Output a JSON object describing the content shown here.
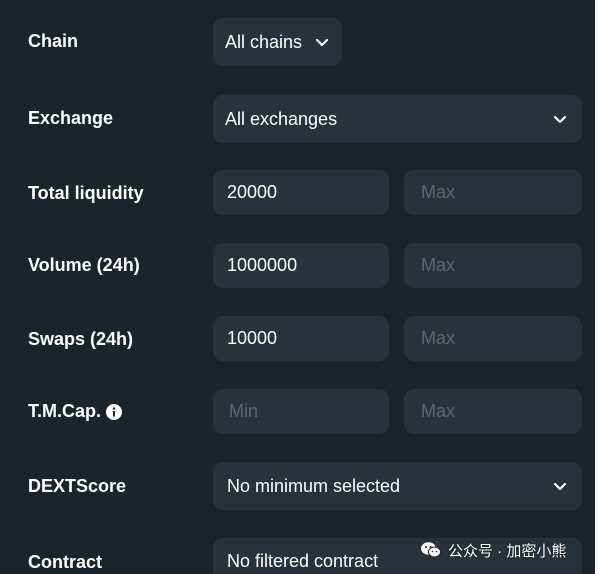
{
  "filters": {
    "chain": {
      "label": "Chain",
      "value": "All chains"
    },
    "exchange": {
      "label": "Exchange",
      "value": "All exchanges"
    },
    "total_liquidity": {
      "label": "Total liquidity",
      "min_value": "20000",
      "max_placeholder": "Max"
    },
    "volume_24h": {
      "label": "Volume (24h)",
      "min_value": "1000000",
      "max_placeholder": "Max"
    },
    "swaps_24h": {
      "label": "Swaps (24h)",
      "min_value": "10000",
      "max_placeholder": "Max"
    },
    "tmcap": {
      "label": "T.M.Cap.",
      "min_placeholder": "Min",
      "max_placeholder": "Max",
      "info_icon": "info-icon"
    },
    "dextscore": {
      "label": "DEXTScore",
      "value": "No minimum selected"
    },
    "contract": {
      "label": "Contract",
      "value": "No filtered contract"
    }
  },
  "watermark": {
    "text": "公众号 · 加密小熊",
    "icon": "wechat-icon"
  },
  "colors": {
    "panel_bg": "#1b232b",
    "field_bg": "#28323c",
    "text": "#ffffff",
    "placeholder": "#5b6670"
  }
}
